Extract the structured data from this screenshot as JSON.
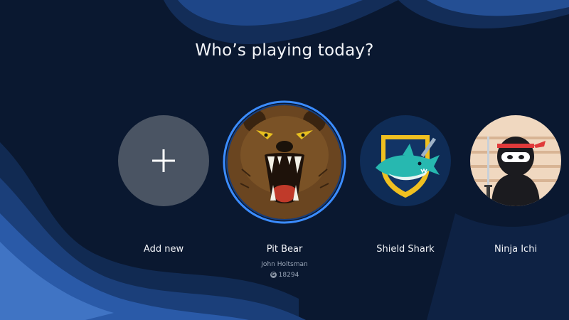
{
  "screen": {
    "title": "Who’s playing today?"
  },
  "profiles": [
    {
      "label": "Add new",
      "icon": "plus-icon"
    },
    {
      "label": "Pit Bear",
      "gamertag": "John Holtsman",
      "score": "18294",
      "selected": true,
      "icon": "bear-avatar"
    },
    {
      "label": "Shield Shark",
      "icon": "shark-avatar"
    },
    {
      "label": "Ninja Ichi",
      "icon": "ninja-avatar"
    }
  ],
  "colors": {
    "background": "#0b1a30",
    "wave_light": "#2a5aa8",
    "selection_ring": "#3b8cff",
    "add_circle": "#4a5463"
  }
}
